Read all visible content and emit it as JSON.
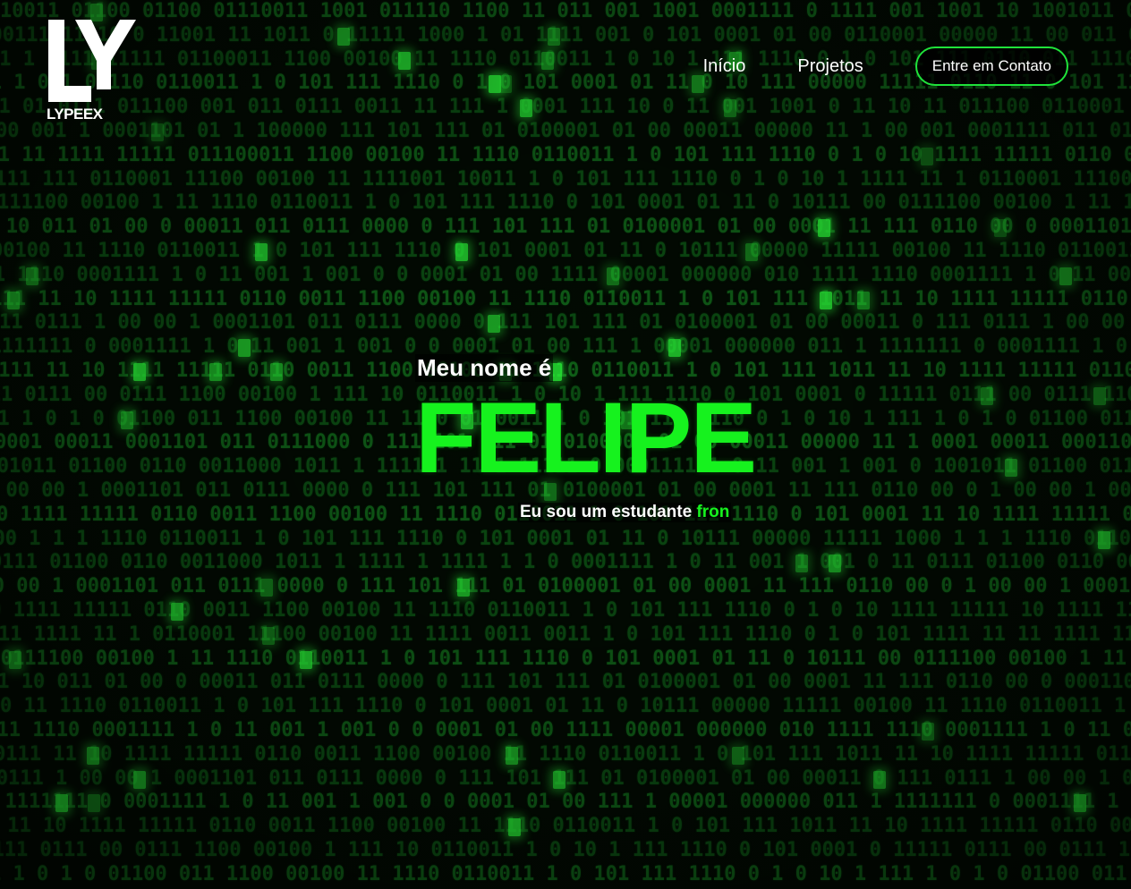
{
  "brand": {
    "logo_text": "LYPEEX",
    "accent_color": "#16f21e"
  },
  "nav": {
    "items": [
      {
        "label": "Início"
      },
      {
        "label": "Projetos"
      }
    ],
    "contact_button": "Entre em Contato"
  },
  "hero": {
    "intro": "Meu nome é",
    "name": "FELIPE",
    "subtitle_prefix": "Eu sou um estudante",
    "subtitle_typed": "fron"
  },
  "background": {
    "pattern_rows": [
      "10011 01100 01100 01110011 1001 011110 1100 11 011 001 1001 0001111 0 1111 001 1001 10 1001011 01100 0110001100 0011 1 1",
      "1000111111110 0 11001 11 1011 0 11111 1000 1 01 1111 001 0 101 0001 01 00 0110001 00000 11 00 011 0001111 011 01110000 0",
      "11 1 1111 11111 01100011 1100 00100 11 1110 0110011 1 0 10 1 111 1110 0 1 0 101 111 0110 011 1110 0110011 1 0 10 1 111 10",
      "1001 1 001 00110 0110011 1 0 101 111 1110 0 1 0 101 0001 01 11 0 10 111 00000 11111 0110 11 0 101 111 1110 0 10 10 111 1",
      "101 01 0111 011100 001 011 0111 0011 11 111 1 0001 111 10 0 11 001 1001 0 11 10 11 011100 0110001 1011 11 111 00 11 01",
      "00 001 1 0001101 01 1 100000 111 101 111 01 0100001 01 00 00011 00000 11 1 00 001 0001111 011 01110000 0 11 001111 0 1",
      "10 1 11 1111 11111 011100011 1100 00100 11 1110 0110011 1 0 101 111 1110 0 1 0 10 1111 11111 0110 011 1100 00100 0110",
      "1111 111 0110001 11100 00100 11 1111001 10011 1 0 101 111 1110 0 1 0 10 1 1111 11 1 0110001 11100 00100 11 111 001 100",
      "00 0111100 00100 1 11 1110 0110011 1 0 101 111 1110 0 101 0001 01 11 0 10111 00 0111100 00100 1 11 1110 0110011 1 0 101",
      "01 10 011 01 00 0 00011 011 0111 0000 0 111 101 111 01 0100001 01 00 0001 11 111 0110 00 0 0001101 011 0111000 0 0110",
      "00100 11 1110 0110011 1 0 101 111 1110 0 101 0001 01 11 0 10111 00000 11111 00100 11 1110 0110011 1 0 101 111 1110 0",
      "1111 1110 0001111 1 0 11 001 1 001 0 0 0001 01 00 1111 00001 000000 010 1111 1110 0001111 1 0 11 001 1 001 0 0 0001",
      "0111 11 10 1111 11111 0110 0011 1100 00100 11 1110 0110011 1 0 101 111 1011 11 10 1111 11111 0110 0011 1100 00100 11",
      "11 0111 1 00 00 1 0001101 011 0111 0000 0 111 101 111 01 0100001 01 00 00011 0 111 0111 1 00 00 1 0001101 011 0111 00",
      "1 1111111 0 0001111 1 0 11 001 1 001 0 0 0001 01 00 111 1 00001 000000 011 1 1111111 0 0001111 1 0 11 001 1 001 0 0",
      "0111 11 10 1111 11111 0110 0011 1100 00100 11 1110 0110011 1 0 101 111 1011 11 10 1111 11111 0110 0011 1100 00100",
      "11111 0111 00 0111 1100 00100 1 111 10 0110011 1 0 10 1 111 1110 0 101 0001 0 11111 0111 00 0111 1100 00100 1 111 1",
      "111 1 0 1 0 01100 011 1100 00100 11 1110 0110011 1 0 101 111 1110 0 1 0 10 1 111 1 0 1 0 01100 011 1100 00100 11 111",
      "0001 00011 0001101 011 0111000 0 111 101 111 01 0100001 01 00 00011 00000 11 1 0001 00011 0001101 011 0111000 0 111",
      "10 01011 01100 0110 0011000 1011 1 1111 1 11 1 11111 0 0001111 1 0 11 001 1 001 0 1001011 01100 0110 0011000 1011 1",
      "1 00 00 1 0001101 011 0111 0000 0 111 101 111 01 0100001 01 00 0001 11 111 0110 00 0 1 00 00 1 0001101 011 0111 0000 0",
      "11 10 1111 11111 0110 0011 1100 00100 11 1110 0110011 1 0 101 111 1110 0 101 0001 11 10 1111 11111 0110 0011 1100 001",
      "1000 1 1 1 1110 0110011 1 0 101 111 1110 0 101 0001 01 11 0 10111 00000 11111 1000 1 1 1 1110 0110011 1 0 101 111 111",
      "0111 01100 0110 0011000 1011 1 1111 1 1111 1 1 0 0001111 1 0 11 001 1 001 0 11 0111 01100 0110 0011000 1011 1 1111 1",
      "1 00 00 1 0001101 011 0111 0000 0 111 101 111 01 0100001 01 00 0001 11 111 0110 00 0 1 00 00 1 0001101 011 0111 0000",
      "10 1111 11111 0110 0011 1100 00100 11 1110 0110011 1 0 101 111 1110 0 1 0 10 1111 11111 10 1111 11111 0110 0011 1100",
      "11 1111 11 1 0110001 11100 00100 11 1111 0011 0011 1 0 101 111 1110 0 1 0 101 1111 11 11 1111 11 1 0110001 11100 0010",
      "00 0111100 00100 1 11 1110 0110011 1 0 101 111 1110 0 101 0001 01 11 0 10111 00 0111100 00100 1 11 1110 0110011 1 0",
      "01 10 011 01 00 0 00011 011 0111 0000 0 111 101 111 01 0100001 01 00 0001 11 111 0110 00 0 0001101 011 0111000 0 0110",
      "00100 11 1110 0110011 1 0 101 111 1110 0 101 0001 01 11 0 10111 00000 11111 00100 11 1110 0110011 1 0 101 111 1110 0",
      "1111 1110 0001111 1 0 11 001 1 001 0 0 0001 01 00 1111 00001 000000 010 1111 1110 0001111 1 0 11 001 1 001 0 0 0001",
      "0111 11 10 1111 11111 0110 0011 1100 00100 11 1110 0110011 1 0 101 111 1011 11 10 1111 11111 0110 0011 1100 00100 11",
      "11 0111 1 00 00 1 0001101 011 0111 0000 0 111 101 111 01 0100001 01 00 00011 0 111 0111 1 00 00 1 0001101 011 0111 00",
      "1 1111111 0 0001111 1 0 11 001 1 001 0 0 0001 01 00 111 1 00001 000000 011 1 1111111 0 0001111 1 0 11 001 1 001 0 0",
      "0111 11 10 1111 11111 0110 0011 1100 00100 11 1110 0110011 1 0 101 111 1011 11 10 1111 11111 0110 0011 1100 00100",
      "11111 0111 00 0111 1100 00100 1 111 10 0110011 1 0 10 1 111 1110 0 101 0001 0 11111 0111 00 0111 1100 00100 1 111 1",
      "1 1 0 1 0 01100 011 1100 00100 11 1110 0110011 1 0 101 111 1110 0 1 0 10 1 111 1 0 1 0 01100 011 1100 00100 11 111"
    ]
  }
}
